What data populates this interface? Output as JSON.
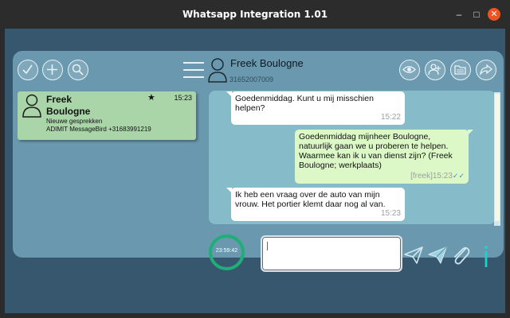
{
  "window": {
    "title": "Whatsapp Integration 1.01",
    "minimize_glyph": "–",
    "maximize_glyph": "□",
    "close_glyph": "✕"
  },
  "toolbar": {
    "left_icons": [
      "check-icon",
      "plus-icon",
      "search-icon"
    ],
    "right_icons": [
      "eye-icon",
      "add-contact-icon",
      "folder-icon",
      "forward-icon"
    ]
  },
  "contact": {
    "name": "Freek  Boulogne",
    "number": "31652007009"
  },
  "chat_list": [
    {
      "name": "Freek Boulogne",
      "time": "15:23",
      "starred_glyph": "★",
      "status": "Nieuwe gesprekken",
      "meta": "ADIMIT MessageBird +31683991219"
    }
  ],
  "messages": [
    {
      "direction": "in",
      "text": "Goedenmiddag. Kunt u mij misschien helpen?",
      "time": "15:22"
    },
    {
      "direction": "out",
      "text": "Goedenmiddag mijnheer Boulogne, natuurlijk gaan we u proberen te helpen. Waarmee kan ik u van dienst zijn? (Freek Boulogne; werkplaats)",
      "sender": "[freek]",
      "time": "15:23",
      "tick": "✓✓"
    },
    {
      "direction": "in",
      "text": "Ik heb een vraag over de auto van mijn vrouw. Het portier klemt daar nog al van.",
      "time": "15:23"
    }
  ],
  "timer": {
    "value": "23:59:42"
  },
  "composer": {
    "value": ""
  },
  "colors": {
    "accent": "#1fae78",
    "panel": "#6a99af",
    "incoming": "#ffffff",
    "outgoing": "#dcf8c6",
    "chat_item": "#a9d5a9"
  }
}
